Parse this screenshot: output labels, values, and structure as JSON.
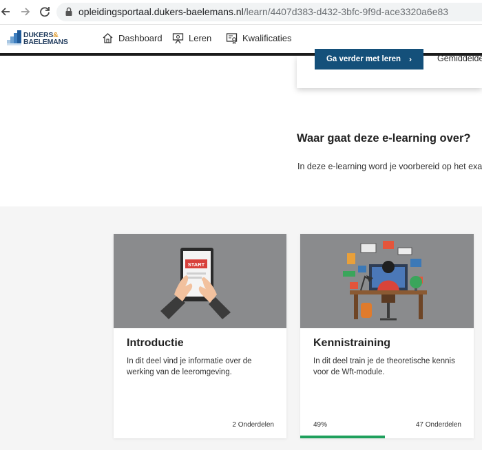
{
  "browser": {
    "url_host": "opleidingsportaal.dukers-baelemans.nl",
    "url_path": "/learn/4407d383-d432-3bfc-9f9d-ace3320a6e83",
    "icons": [
      "back-icon",
      "forward-icon",
      "reload-icon",
      "lock-icon"
    ]
  },
  "header": {
    "logo_line1": "DUKERS",
    "logo_amp": "&",
    "logo_line2": "BAELEMANS",
    "nav": [
      {
        "label": "Dashboard",
        "icon": "home-icon"
      },
      {
        "label": "Leren",
        "icon": "presentation-icon"
      },
      {
        "label": "Kwalificaties",
        "icon": "certificate-icon"
      }
    ]
  },
  "hero": {
    "cta_label": "Ga verder met leren",
    "cta_arrow": "›",
    "side_text": "Gemiddelde"
  },
  "about": {
    "title": "Waar gaat deze e-learning over?",
    "text": "In deze e-learning word je voorbereid op het exa"
  },
  "cards": [
    {
      "title": "Introductie",
      "description": "In dit deel vind je informatie over de werking van de leeromgeving.",
      "parts": "2 Onderdelen",
      "image_label": "START"
    },
    {
      "title": "Kennistraining",
      "description": "In dit deel train je de theoretische kennis voor de Wft-module.",
      "parts": "47 Onderdelen",
      "progress_label": "49%",
      "progress": 0.49
    }
  ],
  "colors": {
    "cta": "#14507a",
    "progress": "#1ea05c",
    "logo_amp": "#e09a2a"
  }
}
